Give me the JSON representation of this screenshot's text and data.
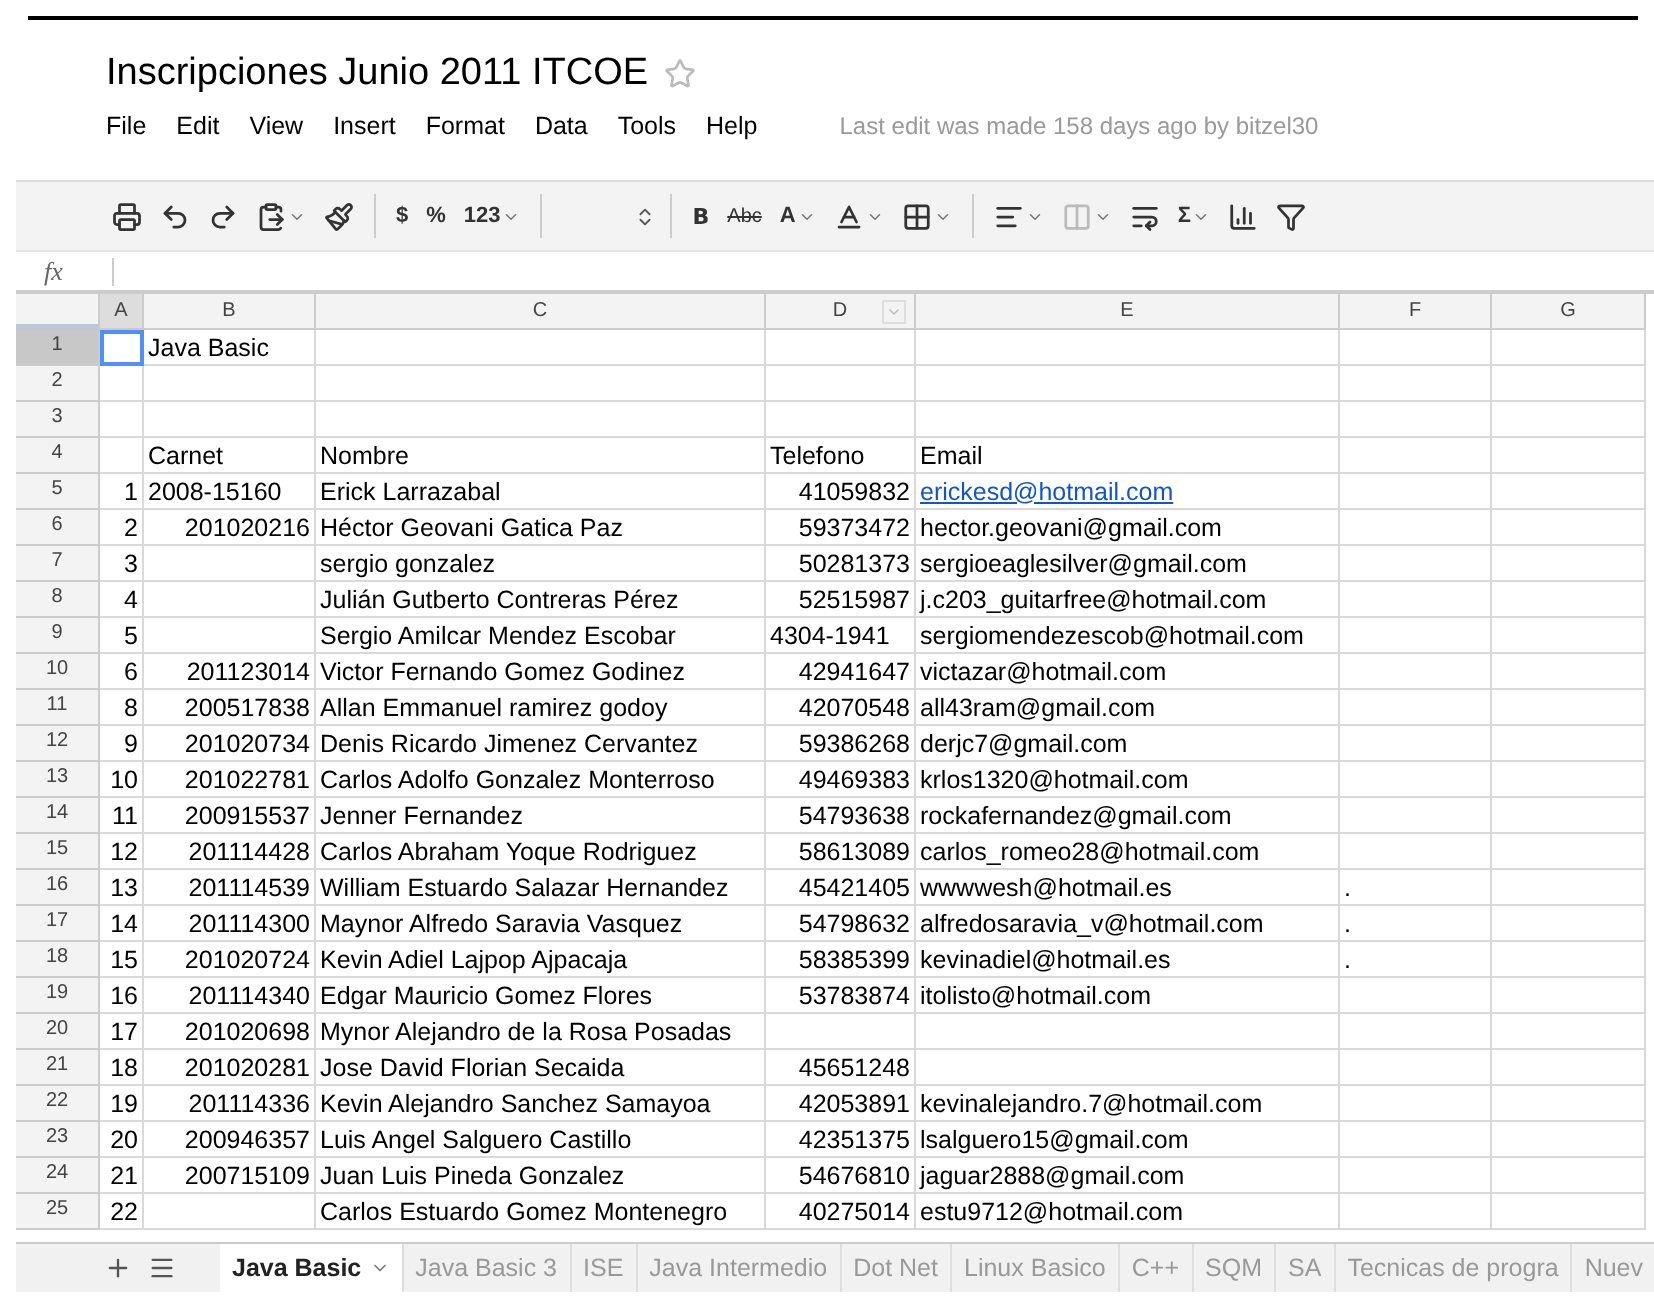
{
  "document": {
    "title": "Inscripciones Junio 2011 ITCOE",
    "starred": false
  },
  "menu": [
    "File",
    "Edit",
    "View",
    "Insert",
    "Format",
    "Data",
    "Tools",
    "Help"
  ],
  "last_edit": "Last edit was made 158 days ago by bitzel30",
  "toolbar": [
    {
      "kind": "icon"
    },
    {
      "kind": "icon"
    },
    {
      "kind": "icon"
    },
    {
      "kind": "icon",
      "menu": true
    },
    {
      "kind": "icon"
    },
    {
      "kind": "separator"
    },
    {
      "kind": "text",
      "label": "$"
    },
    {
      "kind": "text",
      "label": "%"
    },
    {
      "kind": "text",
      "label": "123",
      "menu": true
    },
    {
      "kind": "separator"
    },
    {
      "kind": "spinner"
    },
    {
      "kind": "separator"
    },
    {
      "kind": "text",
      "label": "B",
      "bold": true
    },
    {
      "kind": "text",
      "label": "Abc",
      "strike": true
    },
    {
      "kind": "text",
      "label": "A",
      "menu": true
    },
    {
      "kind": "icon",
      "menu": true
    },
    {
      "kind": "icon",
      "menu": true
    },
    {
      "kind": "separator"
    },
    {
      "kind": "icon",
      "menu": true
    },
    {
      "kind": "icon",
      "menu": true,
      "disabled": true
    },
    {
      "kind": "icon"
    },
    {
      "kind": "text",
      "label": "Σ",
      "menu": true
    },
    {
      "kind": "icon"
    },
    {
      "kind": "icon"
    }
  ],
  "formula_bar": {
    "label": "fx"
  },
  "columns": [
    {
      "letter": "A",
      "selected": true
    },
    {
      "letter": "B",
      "selected": false
    },
    {
      "letter": "C",
      "selected": false
    },
    {
      "letter": "D",
      "selected": false,
      "filter": true
    },
    {
      "letter": "E",
      "selected": false
    },
    {
      "letter": "F",
      "selected": false
    },
    {
      "letter": "G",
      "selected": false
    }
  ],
  "rows": [
    {
      "number": "1",
      "selected": true,
      "cells": {
        "B": "Java Basic"
      }
    },
    {
      "number": "2",
      "selected": false,
      "cells": {}
    },
    {
      "number": "3",
      "selected": false,
      "cells": {}
    },
    {
      "number": "4",
      "selected": false,
      "cells": {
        "B": "Carnet",
        "C": "Nombre",
        "D": "Telefono",
        "E": "Email"
      }
    },
    {
      "number": "5",
      "selected": false,
      "cells": {
        "A": "1",
        "B": "2008-15160",
        "C": "Erick Larrazabal",
        "D": "41059832",
        "E": {
          "text": "erickesd@hotmail.com",
          "link": true
        }
      }
    },
    {
      "number": "6",
      "selected": false,
      "cells": {
        "A": "2",
        "B": "201020216",
        "C": "Héctor Geovani Gatica Paz",
        "D": "59373472",
        "E": "hector.geovani@gmail.com"
      }
    },
    {
      "number": "7",
      "selected": false,
      "cells": {
        "A": "3",
        "C": "sergio gonzalez",
        "D": "50281373",
        "E": "sergioeaglesilver@gmail.com"
      }
    },
    {
      "number": "8",
      "selected": false,
      "cells": {
        "A": "4",
        "C": "Julián Gutberto Contreras Pérez",
        "D": "52515987",
        "E": "j.c203_guitarfree@hotmail.com"
      }
    },
    {
      "number": "9",
      "selected": false,
      "cells": {
        "A": "5",
        "C": "Sergio Amilcar Mendez Escobar",
        "D": "4304-1941",
        "E": "sergiomendezescob@hotmail.com"
      }
    },
    {
      "number": "10",
      "selected": false,
      "cells": {
        "A": "6",
        "B": "201123014",
        "C": "Victor Fernando Gomez Godinez",
        "D": "42941647",
        "E": "victazar@hotmail.com"
      }
    },
    {
      "number": "11",
      "selected": false,
      "cells": {
        "A": "8",
        "B": "200517838",
        "C": "Allan Emmanuel ramirez godoy",
        "D": "42070548",
        "E": "all43ram@gmail.com"
      }
    },
    {
      "number": "12",
      "selected": false,
      "cells": {
        "A": "9",
        "B": "201020734",
        "C": "Denis Ricardo Jimenez Cervantez",
        "D": "59386268",
        "E": "derjc7@gmail.com"
      }
    },
    {
      "number": "13",
      "selected": false,
      "cells": {
        "A": "10",
        "B": "201022781",
        "C": "Carlos Adolfo Gonzalez Monterroso",
        "D": "49469383",
        "E": "krlos1320@hotmail.com"
      }
    },
    {
      "number": "14",
      "selected": false,
      "cells": {
        "A": "11",
        "B": "200915537",
        "C": "Jenner Fernandez",
        "D": "54793638",
        "E": "rockafernandez@gmail.com"
      }
    },
    {
      "number": "15",
      "selected": false,
      "cells": {
        "A": "12",
        "B": "201114428",
        "C": "Carlos Abraham Yoque Rodriguez",
        "D": "58613089",
        "E": "carlos_romeo28@hotmail.com"
      }
    },
    {
      "number": "16",
      "selected": false,
      "cells": {
        "A": "13",
        "B": "201114539",
        "C": "William Estuardo Salazar Hernandez",
        "D": "45421405",
        "E": "wwwwesh@hotmail.es",
        "F": "."
      }
    },
    {
      "number": "17",
      "selected": false,
      "cells": {
        "A": "14",
        "B": "201114300",
        "C": "Maynor Alfredo Saravia Vasquez",
        "D": "54798632",
        "E": "alfredosaravia_v@hotmail.com",
        "F": "."
      }
    },
    {
      "number": "18",
      "selected": false,
      "cells": {
        "A": "15",
        "B": "201020724",
        "C": "Kevin Adiel Lajpop Ajpacaja",
        "D": "58385399",
        "E": "kevinadiel@hotmail.es",
        "F": "."
      }
    },
    {
      "number": "19",
      "selected": false,
      "cells": {
        "A": "16",
        "B": "201114340",
        "C": "Edgar Mauricio Gomez Flores",
        "D": "53783874",
        "E": "itolisto@hotmail.com"
      }
    },
    {
      "number": "20",
      "selected": false,
      "cells": {
        "A": "17",
        "B": "201020698",
        "C": "Mynor Alejandro de la Rosa Posadas"
      }
    },
    {
      "number": "21",
      "selected": false,
      "cells": {
        "A": "18",
        "B": "201020281",
        "C": "Jose David Florian Secaida",
        "D": "45651248"
      }
    },
    {
      "number": "22",
      "selected": false,
      "cells": {
        "A": "19",
        "B": "201114336",
        "C": "Kevin Alejandro Sanchez Samayoa",
        "D": "42053891",
        "E": "kevinalejandro.7@hotmail.com"
      }
    },
    {
      "number": "23",
      "selected": false,
      "cells": {
        "A": "20",
        "B": "200946357",
        "C": "Luis Angel Salguero Castillo",
        "D": "42351375",
        "E": "lsalguero15@gmail.com"
      }
    },
    {
      "number": "24",
      "selected": false,
      "cells": {
        "A": "21",
        "B": "200715109",
        "C": "Juan Luis Pineda Gonzalez",
        "D": "54676810",
        "E": "jaguar2888@gmail.com"
      }
    },
    {
      "number": "25",
      "selected": false,
      "cells": {
        "A": "22",
        "C": "Carlos Estuardo Gomez Montenegro",
        "D": "40275014",
        "E": "estu9712@hotmail.com"
      }
    }
  ],
  "sheet_tabs": [
    {
      "label": "Java Basic",
      "selected": true
    },
    {
      "label": "Java Basic 3",
      "selected": false
    },
    {
      "label": "ISE",
      "selected": false
    },
    {
      "label": "Java Intermedio",
      "selected": false
    },
    {
      "label": "Dot Net",
      "selected": false
    },
    {
      "label": "Linux Basico",
      "selected": false
    },
    {
      "label": "C++",
      "selected": false
    },
    {
      "label": "SQM",
      "selected": false
    },
    {
      "label": "SA",
      "selected": false
    },
    {
      "label": "Tecnicas de progra",
      "selected": false
    },
    {
      "label": "Nuev",
      "selected": false
    }
  ]
}
